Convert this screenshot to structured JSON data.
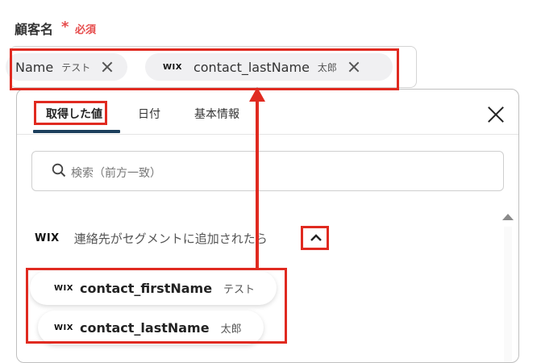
{
  "field": {
    "label": "顧客名",
    "required_mark": "*",
    "required_text": "必須"
  },
  "chips": [
    {
      "main": "Name",
      "sub": "テスト",
      "icon": "close-icon"
    },
    {
      "logo": "WIX",
      "main": "contact_lastName",
      "sub": "太郎",
      "icon": "close-icon"
    }
  ],
  "dropdown": {
    "tabs": [
      {
        "label": "取得した値",
        "active": true
      },
      {
        "label": "日付",
        "active": false
      },
      {
        "label": "基本情報",
        "active": false
      }
    ],
    "search": {
      "placeholder": "検索（前方一致）"
    },
    "group": {
      "logo": "WIX",
      "title": "連絡先がセグメントに追加されたら",
      "expanded": true
    },
    "options": [
      {
        "logo": "WIX",
        "main": "contact_firstName",
        "sub": "テスト"
      },
      {
        "logo": "WIX",
        "main": "contact_lastName",
        "sub": "太郎"
      }
    ]
  },
  "colors": {
    "highlight": "#e02a20",
    "required": "#e64c4c",
    "tab_underline": "#1c3f5c"
  }
}
